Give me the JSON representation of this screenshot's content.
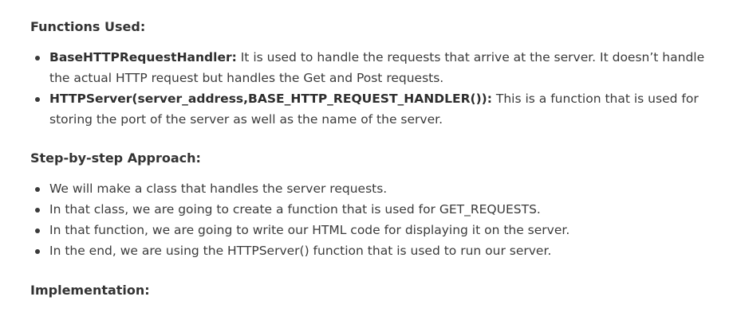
{
  "functions_section": {
    "heading": "Functions Used:",
    "items": [
      {
        "term": "BaseHTTPRequestHandler:",
        "text": " It is used to handle the requests that arrive at the server. It doesn’t handle the actual HTTP request but handles the Get and Post requests."
      },
      {
        "term": "HTTPServer(server_address,BASE_HTTP_REQUEST_HANDLER()):",
        "text": " This is a function that is used for storing the port of the server as well as the name of the server."
      }
    ]
  },
  "steps_section": {
    "heading": "Step-by-step Approach:",
    "items": [
      "We will make a class that handles the server requests.",
      "In that class, we are going to create a function that is used for GET_REQUESTS.",
      "In that function, we are going to write our HTML code for displaying it on the server.",
      "In the end, we are using the HTTPServer() function that is used to run our server."
    ]
  },
  "implementation_section": {
    "heading": "Implementation:"
  }
}
